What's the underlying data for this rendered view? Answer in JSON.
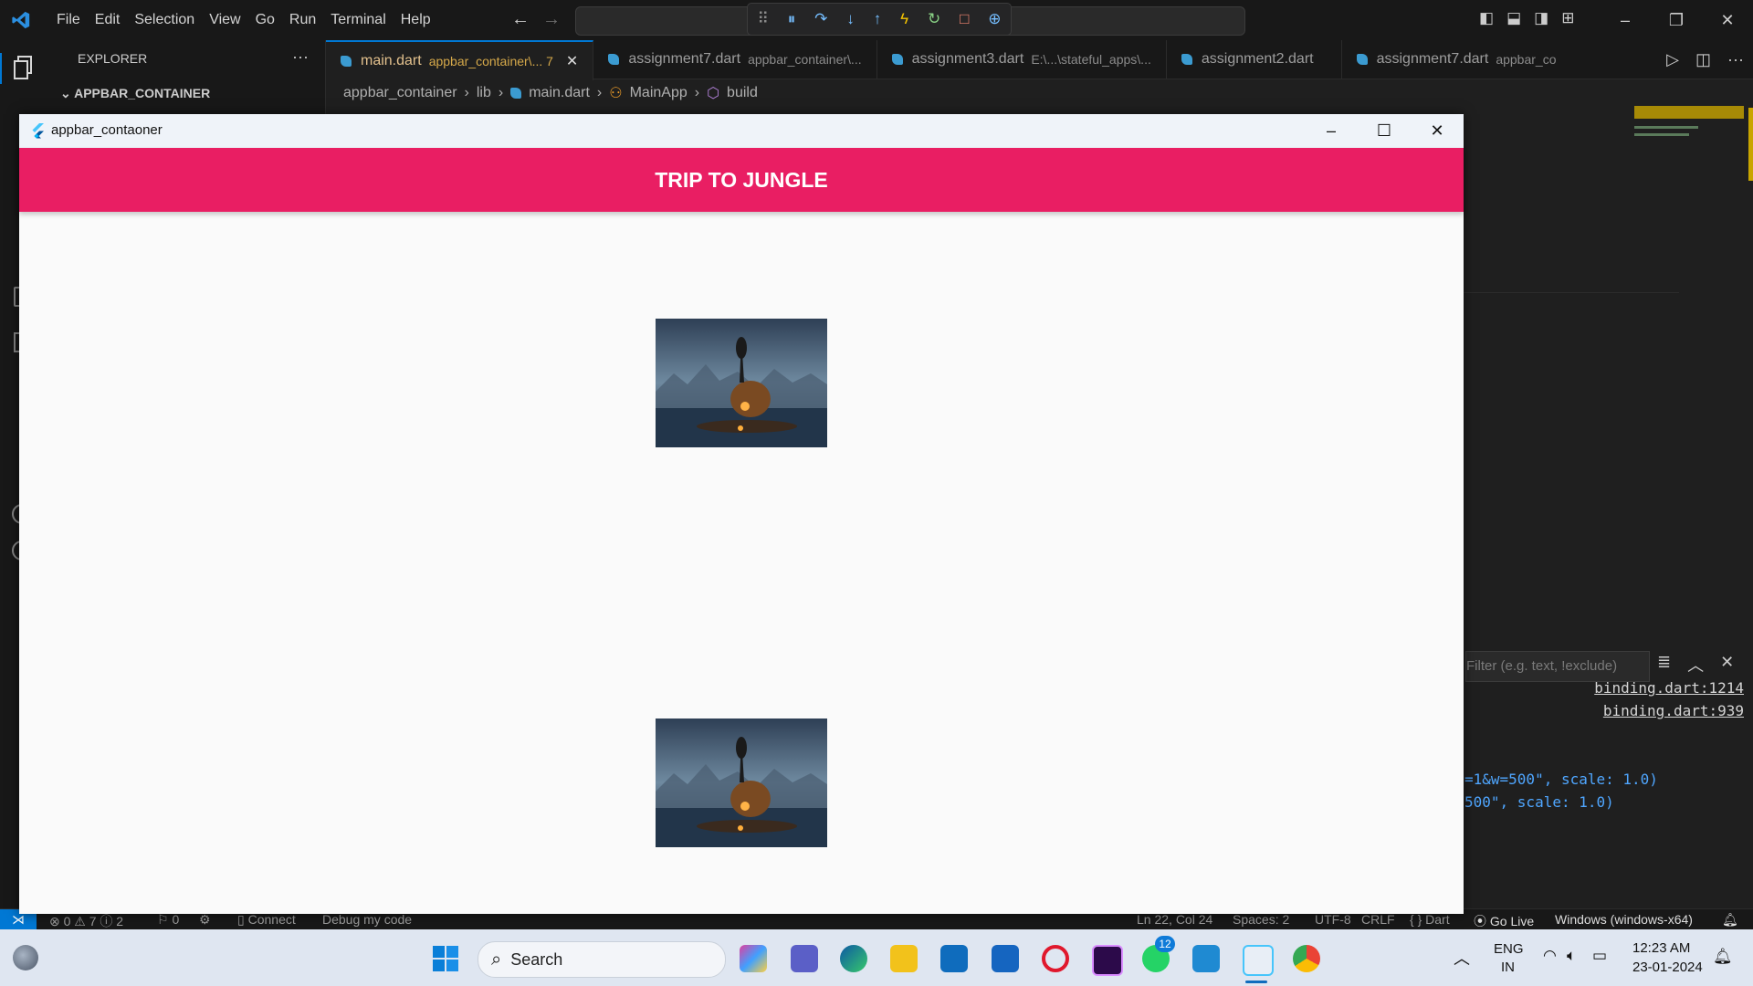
{
  "menu": [
    "File",
    "Edit",
    "Selection",
    "View",
    "Go",
    "Run",
    "Terminal",
    "Help"
  ],
  "explorer": {
    "header": "EXPLORER",
    "more": "···",
    "section": "APPBAR_CONTAINER"
  },
  "tabs": [
    {
      "name": "main.dart",
      "desc": "appbar_container\\... 7",
      "active": true
    },
    {
      "name": "assignment7.dart",
      "desc": "appbar_container\\..."
    },
    {
      "name": "assignment3.dart",
      "desc": "E:\\...\\stateful_apps\\..."
    },
    {
      "name": "assignment2.dart",
      "desc": ""
    },
    {
      "name": "assignment7.dart",
      "desc": "appbar_co"
    }
  ],
  "breadcrumb": [
    "appbar_container",
    "lib",
    "main.dart",
    "MainApp",
    "build"
  ],
  "panel": {
    "filter_placeholder": "Filter (e.g. text, !exclude)",
    "lines": [
      "binding.dart:1214",
      "binding.dart:939",
      "=1&w=500\", scale: 1.0)",
      "500\", scale: 1.0)"
    ]
  },
  "app": {
    "window_title": "appbar_contaoner",
    "appbar_title": "TRIP TO JUNGLE"
  },
  "status": {
    "problems": "⊗ 0 ⚠ 7 ⓘ 2",
    "ports": "⚐ 0",
    "connect": "Connect",
    "debug": "Debug my code",
    "position": "Ln 22, Col 24",
    "spaces": "Spaces: 2",
    "encoding": "UTF-8",
    "eol": "CRLF",
    "language": "{ } Dart",
    "golive": "Go Live",
    "device": "Windows (windows-x64)"
  },
  "taskbar": {
    "search": "Search",
    "lang1": "ENG",
    "lang2": "IN",
    "time": "12:23 AM",
    "date": "23-01-2024",
    "whatsapp_badge": "12"
  },
  "colors": {
    "appbar": "#e91e63",
    "accent": "#0078d4"
  }
}
